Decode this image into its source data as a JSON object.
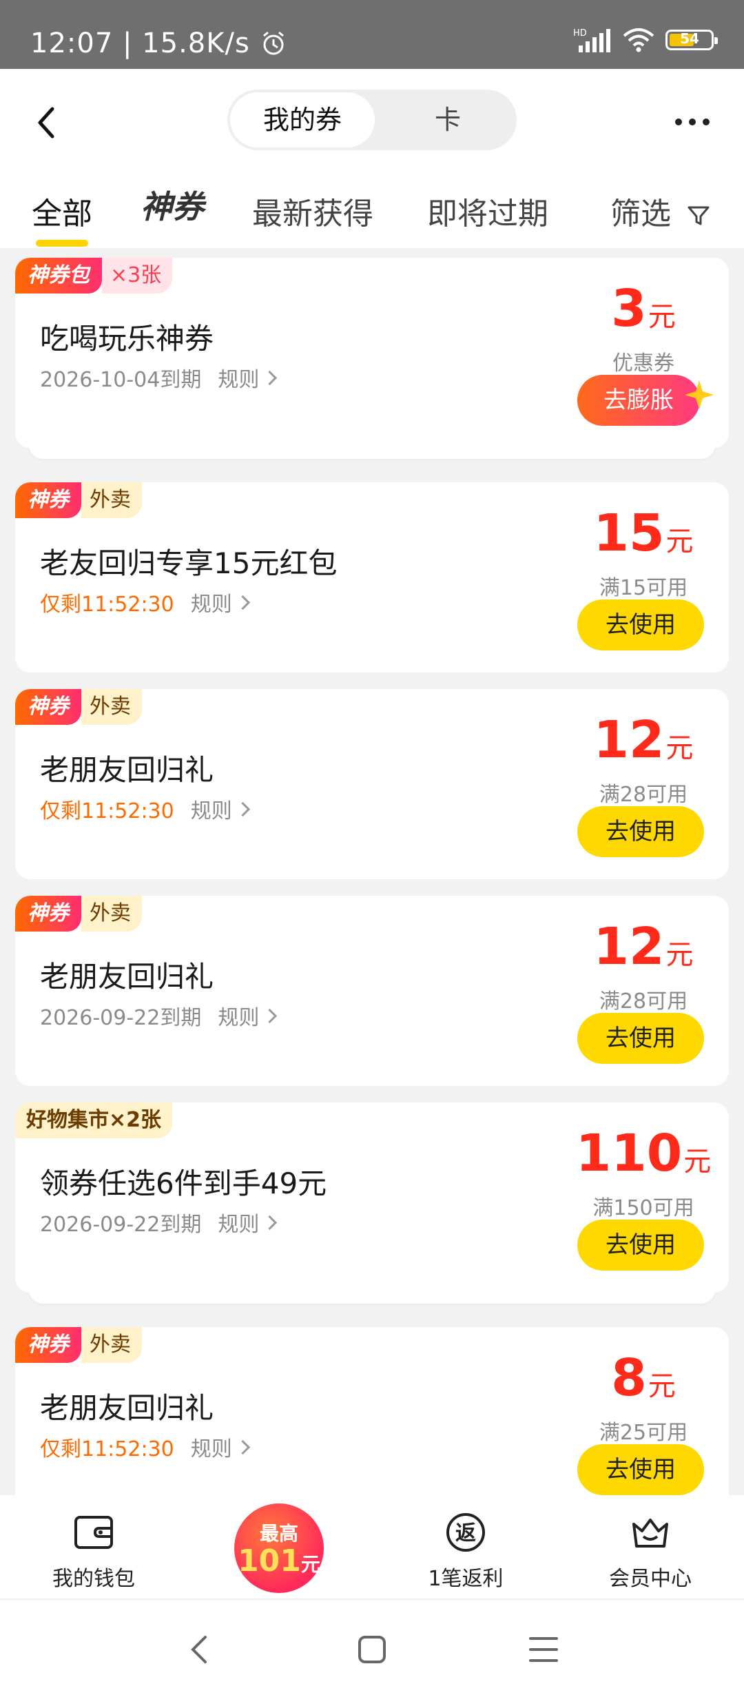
{
  "status_bar": {
    "time_speed": "12:07 | 15.8K/s",
    "network": "HD",
    "battery": "54"
  },
  "header": {
    "segments": [
      "我的券",
      "卡"
    ],
    "tabs": {
      "all": "全部",
      "shenquan": "神券",
      "latest": "最新获得",
      "expiring": "即将过期",
      "filter": "筛选"
    }
  },
  "cards": [
    {
      "tag_main": "神券包",
      "tag_sub": "×3张",
      "title": "吃喝玩乐神券",
      "meta": "2026-10-04到期",
      "rule": "规则",
      "amount": "3",
      "unit": "元",
      "cond": "优惠券",
      "button": "去膨胀"
    },
    {
      "tag_main": "神券",
      "tag_sub": "外卖",
      "title": "老友回归专享15元红包",
      "meta": "仅剩11:52:30",
      "rule": "规则",
      "amount": "15",
      "unit": "元",
      "cond": "满15可用",
      "button": "去使用"
    },
    {
      "tag_main": "神券",
      "tag_sub": "外卖",
      "title": "老朋友回归礼",
      "meta": "仅剩11:52:30",
      "rule": "规则",
      "amount": "12",
      "unit": "元",
      "cond": "满28可用",
      "button": "去使用"
    },
    {
      "tag_main": "神券",
      "tag_sub": "外卖",
      "title": "老朋友回归礼",
      "meta": "2026-09-22到期",
      "rule": "规则",
      "amount": "12",
      "unit": "元",
      "cond": "满28可用",
      "button": "去使用"
    },
    {
      "tag_main": "好物集市×2张",
      "title": "领券任选6件到手49元",
      "meta": "2026-09-22到期",
      "rule": "规则",
      "amount": "110",
      "unit": "元",
      "cond": "满150可用",
      "button": "去使用"
    },
    {
      "tag_main": "神券",
      "tag_sub": "外卖",
      "title": "老朋友回归礼",
      "meta": "仅剩11:52:30",
      "rule": "规则",
      "amount": "8",
      "unit": "元",
      "cond": "满25可用",
      "button": "去使用"
    }
  ],
  "bottom_bar": {
    "wallet": "我的钱包",
    "bonus_top": "最高",
    "bonus_amount": "101",
    "bonus_unit": "元",
    "rebate": "1笔返利",
    "rebate_glyph": "返",
    "member": "会员中心"
  },
  "colors": {
    "accent_yellow": "#ffd800",
    "price_red": "#ff2a1a",
    "urgent_orange": "#ff6a00"
  }
}
